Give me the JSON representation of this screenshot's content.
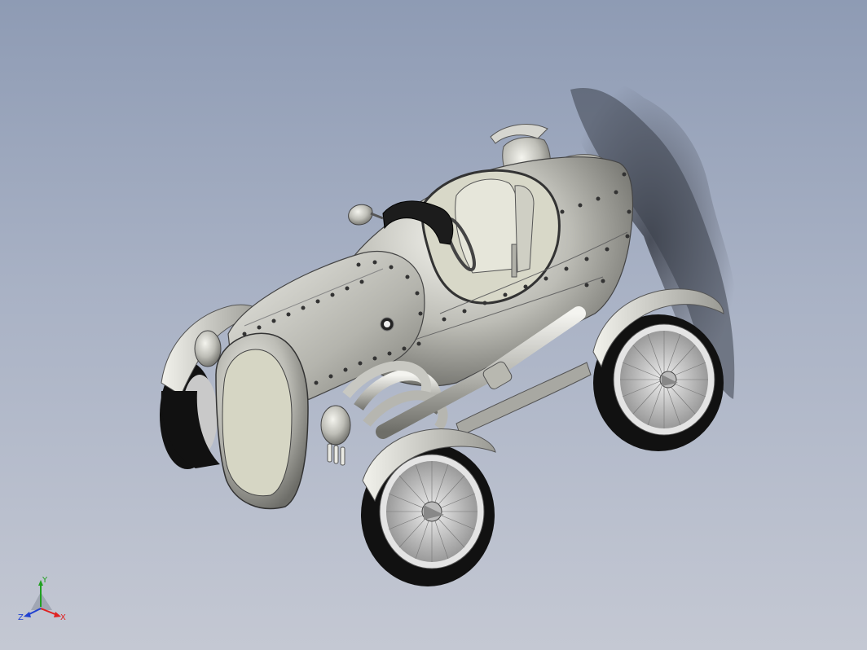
{
  "viewport": {
    "background_top": "#8e9bb4",
    "background_bottom": "#c4c8d3"
  },
  "model": {
    "body_color": "#c8c8c2",
    "tire_color": "#111111",
    "interior_color": "#d8d8c8"
  },
  "triad": {
    "x_label": "X",
    "y_label": "Y",
    "z_label": "Z",
    "x_color": "#e02020",
    "y_color": "#20a020",
    "z_color": "#2040d0"
  }
}
